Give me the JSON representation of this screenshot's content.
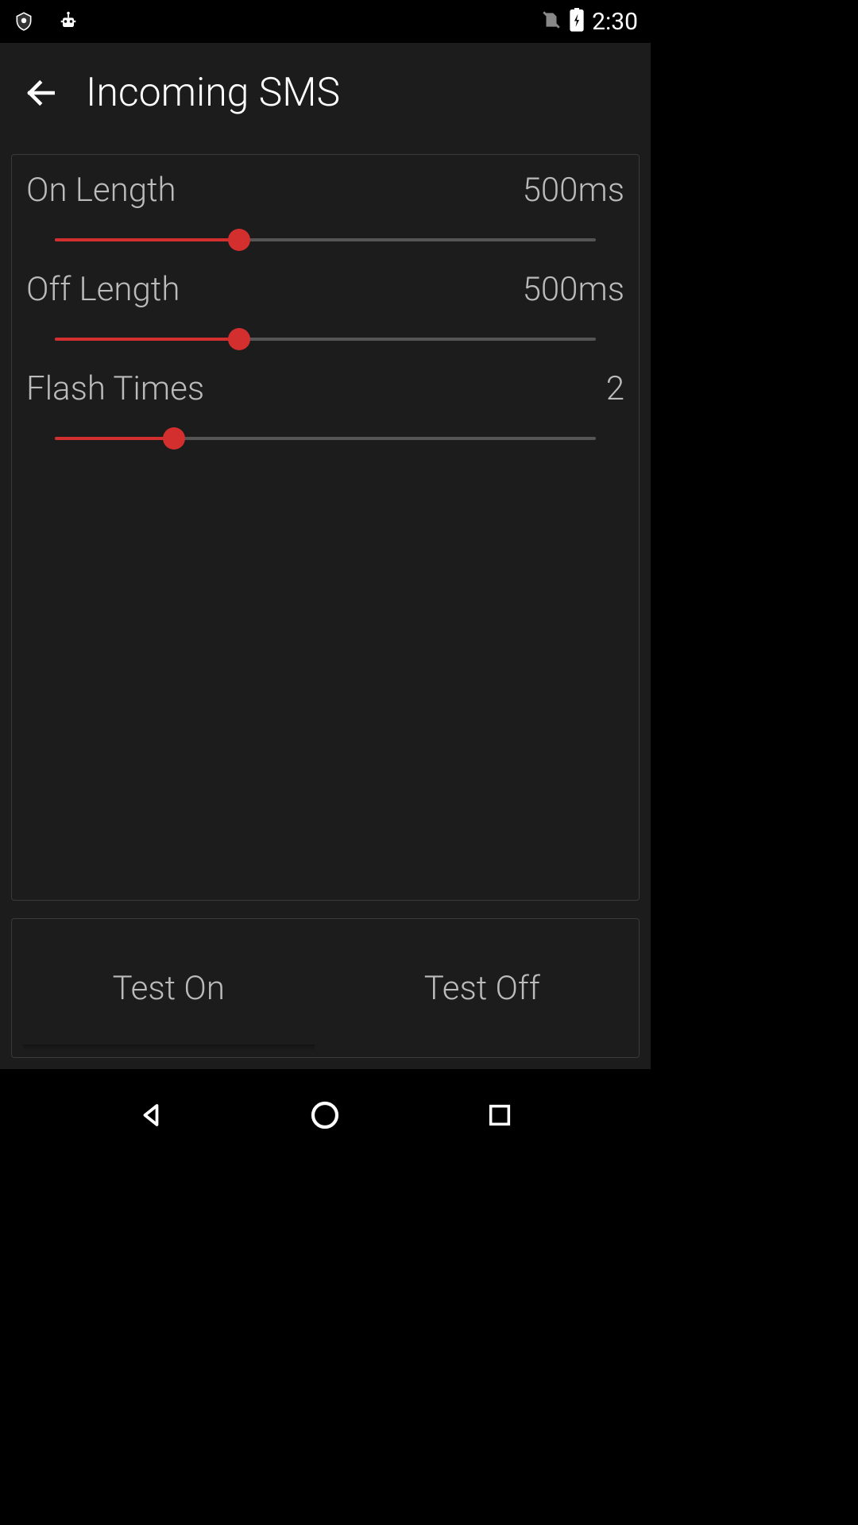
{
  "statusBar": {
    "time": "2:30"
  },
  "appBar": {
    "title": "Incoming SMS"
  },
  "sliders": {
    "onLength": {
      "label": "On Length",
      "value": "500ms",
      "percent": 34
    },
    "offLength": {
      "label": "Off Length",
      "value": "500ms",
      "percent": 34
    },
    "flashTimes": {
      "label": "Flash Times",
      "value": "2",
      "percent": 22
    }
  },
  "testButtons": {
    "testOn": "Test On",
    "testOff": "Test Off"
  },
  "colors": {
    "accent": "#d32f2f",
    "background": "#1c1c1c",
    "textLight": "#bbbbbb"
  }
}
